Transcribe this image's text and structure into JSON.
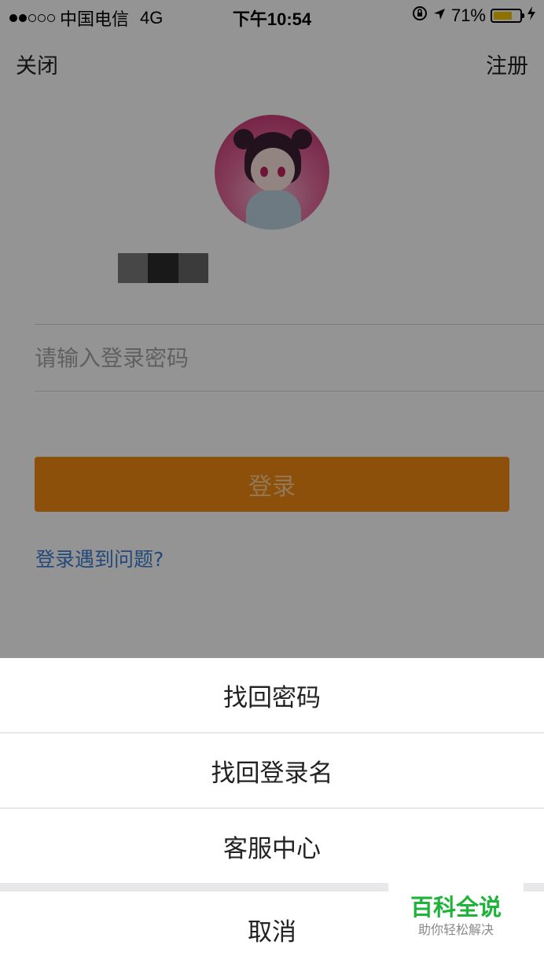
{
  "status_bar": {
    "carrier": "中国电信",
    "network": "4G",
    "time": "下午10:54",
    "battery_percent": "71%",
    "battery_level": 0.71,
    "signal_bars_filled": 2,
    "signal_bars_total": 5
  },
  "nav": {
    "close_label": "关闭",
    "register_label": "注册"
  },
  "login_form": {
    "password_placeholder": "请输入登录密码",
    "login_button_label": "登录",
    "trouble_link": "登录遇到问题?"
  },
  "action_sheet": {
    "options": [
      {
        "label": "找回密码"
      },
      {
        "label": "找回登录名"
      },
      {
        "label": "客服中心"
      }
    ],
    "cancel_label": "取消"
  },
  "watermark": {
    "title": "百科全说",
    "subtitle": "助你轻松解决"
  },
  "colors": {
    "login_button": "#f28a12",
    "link": "#3b7fd1",
    "battery": "#f5c400",
    "watermark": "#1fb33a"
  }
}
